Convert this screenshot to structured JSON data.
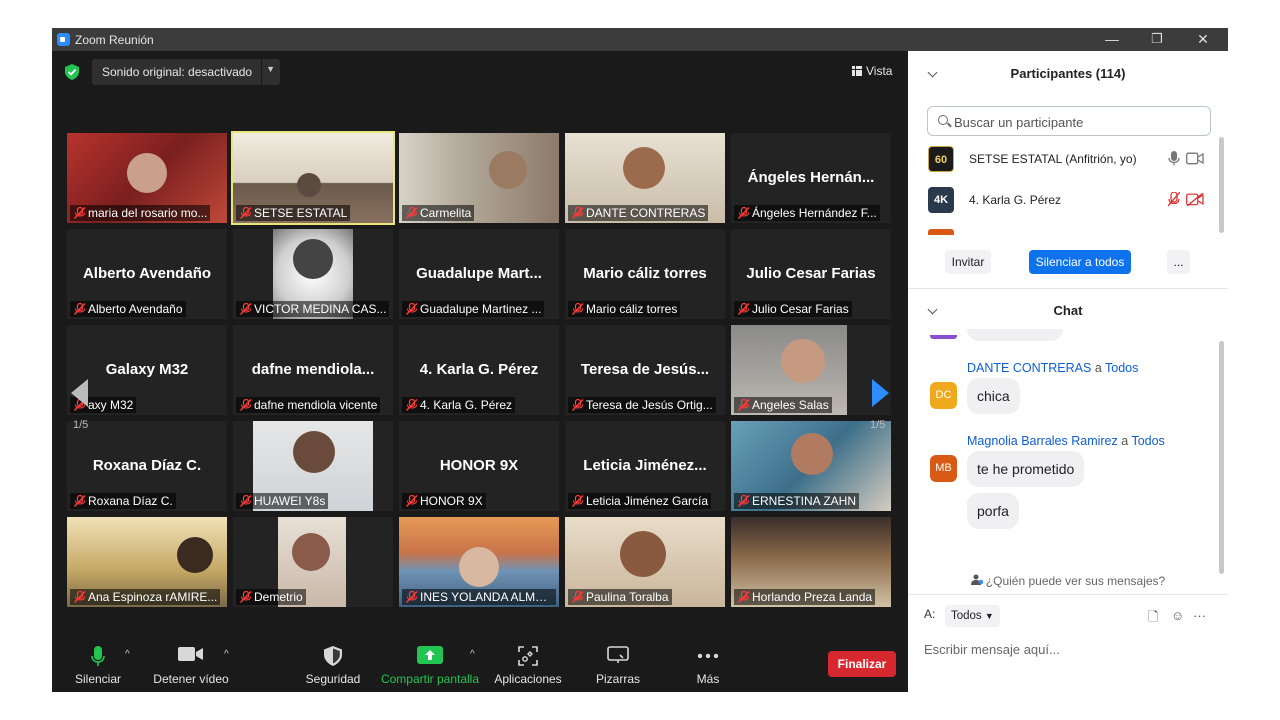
{
  "window": {
    "title": "Zoom Reunión",
    "controls": {
      "minimize": "—",
      "restore": "❐",
      "close": "✕"
    }
  },
  "meeting": {
    "sound_label": "Sonido original: desactivado",
    "view_label": "Vista",
    "page_left": "1/5",
    "page_right": "1/5",
    "tiles": [
      {
        "name": "maria del rosario mo...",
        "big": "",
        "video": true
      },
      {
        "name": "SETSE ESTATAL",
        "big": "",
        "video": true,
        "active": true
      },
      {
        "name": "Carmelita",
        "big": "",
        "video": true
      },
      {
        "name": "DANTE CONTRERAS",
        "big": "",
        "video": true
      },
      {
        "name": "Ángeles Hernández F...",
        "big": "Ángeles  Hernán...",
        "video": false
      },
      {
        "name": "Alberto Avendaño",
        "big": "Alberto Avendaño",
        "video": false
      },
      {
        "name": "VICTOR MEDINA CAS...",
        "big": "",
        "video": true
      },
      {
        "name": "Guadalupe Martinez ...",
        "big": "Guadalupe  Mart...",
        "video": false
      },
      {
        "name": "Mario cáliz torres",
        "big": "Mario cáliz torres",
        "video": false
      },
      {
        "name": "Julio Cesar Farias",
        "big": "Julio Cesar Farias",
        "video": false
      },
      {
        "name": "axy M32",
        "big": "Galaxy M32",
        "video": false
      },
      {
        "name": "dafne mendiola vicente",
        "big": "dafne  mendiola...",
        "video": false
      },
      {
        "name": "4. Karla G. Pérez",
        "big": "4. Karla G. Pérez",
        "video": false
      },
      {
        "name": "Teresa de Jesús Ortig...",
        "big": "Teresa de Jesús...",
        "video": false
      },
      {
        "name": "Angeles Salas",
        "big": "",
        "video": true
      },
      {
        "name": "Roxana Díaz C.",
        "big": "Roxana Díaz C.",
        "video": false
      },
      {
        "name": "HUAWEI Y8s",
        "big": "",
        "video": true
      },
      {
        "name": "HONOR 9X",
        "big": "HONOR 9X",
        "video": false
      },
      {
        "name": "Leticia Jiménez García",
        "big": "Leticia  Jiménez...",
        "video": false
      },
      {
        "name": "ERNESTINA ZAHN",
        "big": "",
        "video": true
      },
      {
        "name": "Ana Espinoza rAMIRE...",
        "big": "",
        "video": true
      },
      {
        "name": "Demetrio",
        "big": "",
        "video": true
      },
      {
        "name": "INES YOLANDA ALME...",
        "big": "",
        "video": true
      },
      {
        "name": "Paulina Toralba",
        "big": "",
        "video": true
      },
      {
        "name": "Horlando Preza Landa",
        "big": "",
        "video": true
      }
    ]
  },
  "toolbar": {
    "mute": "Silenciar",
    "stop_video": "Detener vídeo",
    "security": "Seguridad",
    "share": "Compartir pantalla",
    "apps": "Aplicaciones",
    "whiteboards": "Pizarras",
    "more": "Más",
    "end": "Finalizar",
    "caret": "^"
  },
  "participants": {
    "title": "Participantes (114)",
    "search_placeholder": "Buscar un participante",
    "rows": [
      {
        "avatar": "60",
        "name": "SETSE ESTATAL (Anfitrión, yo)",
        "muted": false
      },
      {
        "avatar": "4K",
        "name": "4. Karla G. Pérez",
        "muted": true
      }
    ],
    "invite": "Invitar",
    "mute_all": "Silenciar a todos",
    "more": "..."
  },
  "chat": {
    "title": "Chat",
    "messages": [
      {
        "sender": "DANTE CONTRERAS",
        "to_word": "a",
        "to": "Todos",
        "initials": "DC",
        "texts": [
          "chica"
        ]
      },
      {
        "sender": "Magnolia Barrales Ramirez",
        "to_word": "a",
        "to": "Todos",
        "initials": "MB",
        "texts": [
          "te he prometido",
          "porfa"
        ]
      }
    ],
    "who_sees": "¿Quién puede ver sus mensajes?",
    "to_label": "A:",
    "to_value": "Todos",
    "input_placeholder": "Escribir mensaje aquí...",
    "file_icon": "🗋",
    "emoji_icon": "☺",
    "more_icon": "···"
  },
  "colors": {
    "accent_blue": "#0e72ed",
    "end_red": "#d8282f",
    "share_green": "#23c552",
    "active_border": "#e6e67a"
  }
}
